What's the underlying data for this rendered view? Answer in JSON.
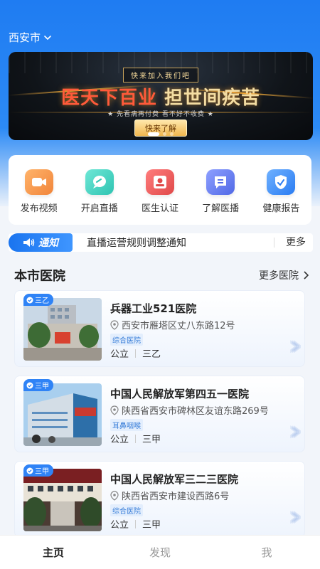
{
  "header": {
    "city": "西安市"
  },
  "banner": {
    "tag": "快来加入我们吧",
    "title_part1": "医天下百业",
    "title_part2": "担世间疾苦",
    "subtitle": "★ 先看病再付费 看不好不收费 ★",
    "button": "快来了解"
  },
  "quick_menu": [
    {
      "label": "发布视频",
      "icon": "video-camera-icon",
      "color": "#f39a4a"
    },
    {
      "label": "开启直播",
      "icon": "live-chat-icon",
      "color": "#3ed3c1"
    },
    {
      "label": "医生认证",
      "icon": "doctor-badge-icon",
      "color": "#ee5b5b"
    },
    {
      "label": "了解医播",
      "icon": "message-board-icon",
      "color": "#5a76f0"
    },
    {
      "label": "健康报告",
      "icon": "hand-shield-icon",
      "color": "#2f8cf6"
    }
  ],
  "notice": {
    "tag": "通知",
    "text": "直播运营规则调整通知",
    "more": "更多"
  },
  "section": {
    "title": "本市医院",
    "more": "更多医院"
  },
  "hospitals": [
    {
      "badge": "三乙",
      "name": "兵器工业521医院",
      "address": "西安市雁塔区丈八东路12号",
      "type": "综合医院",
      "ownership": "公立",
      "grade": "三乙"
    },
    {
      "badge": "三甲",
      "name": "中国人民解放军第四五一医院",
      "address": "陕西省西安市碑林区友谊东路269号",
      "type": "耳鼻咽喉",
      "ownership": "公立",
      "grade": "三甲"
    },
    {
      "badge": "三甲",
      "name": "中国人民解放军三二三医院",
      "address": "陕西省西安市建设西路6号",
      "type": "综合医院",
      "ownership": "公立",
      "grade": "三甲"
    }
  ],
  "tabbar": [
    {
      "label": "主页",
      "active": true
    },
    {
      "label": "发现",
      "active": false
    },
    {
      "label": "我",
      "active": false
    }
  ]
}
